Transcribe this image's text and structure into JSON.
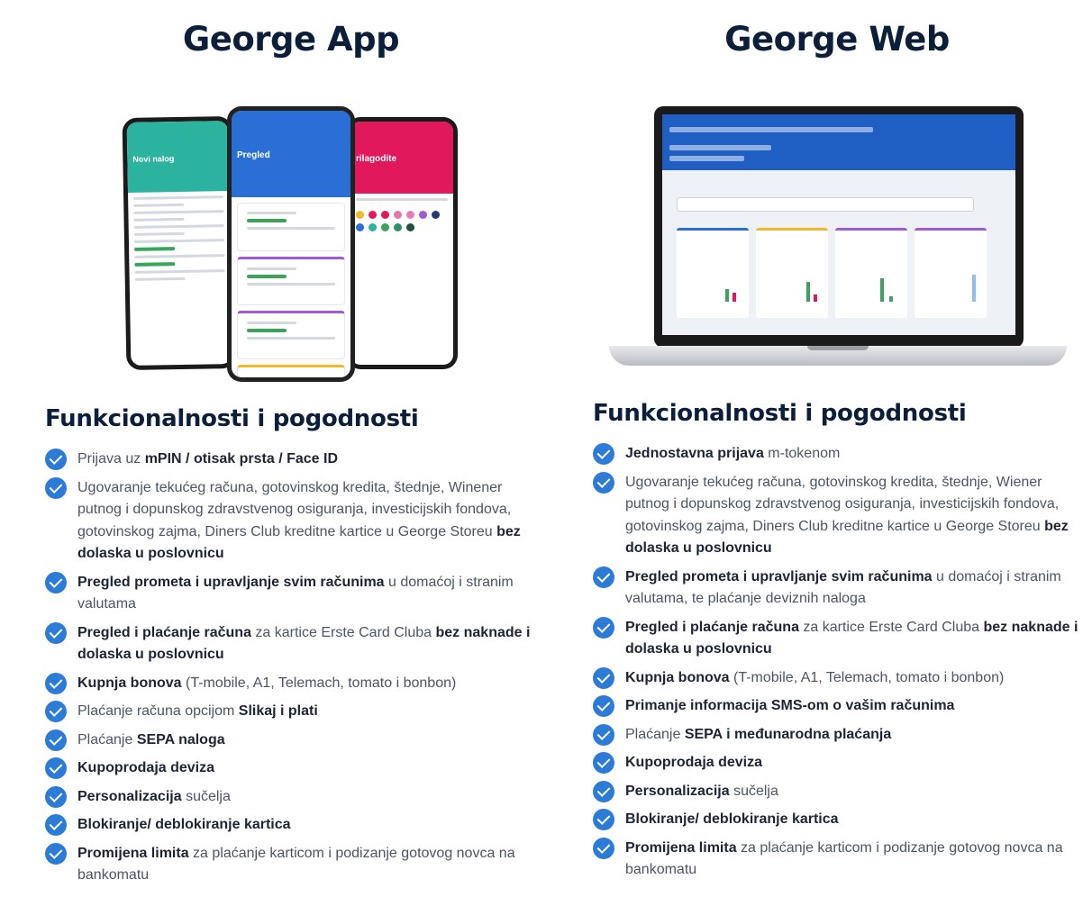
{
  "left": {
    "title": "George App",
    "subtitle": "Funkcionalnosti i pogodnosti",
    "features": [
      [
        {
          "t": "Prijava uz ",
          "b": false
        },
        {
          "t": "mPIN / otisak prsta / Face ID",
          "b": true
        }
      ],
      [
        {
          "t": "Ugovaranje tekućeg računa, gotovinskog kredita, štednje, Winener putnog i dopunskog zdravstvenog osiguranja, investicijskih fondova, gotovinskog zajma, Diners Club kreditne kartice u George Storeu ",
          "b": false
        },
        {
          "t": "bez dolaska u poslovnicu",
          "b": true
        }
      ],
      [
        {
          "t": "Pregled prometa i upravljanje svim računima",
          "b": true
        },
        {
          "t": " u domaćoj i stranim valutama",
          "b": false
        }
      ],
      [
        {
          "t": "Pregled i plaćanje računa",
          "b": true
        },
        {
          "t": " za kartice Erste Card Cluba ",
          "b": false
        },
        {
          "t": "bez naknade i dolaska u poslovnicu",
          "b": true
        }
      ],
      [
        {
          "t": "Kupnja bonova",
          "b": true
        },
        {
          "t": " (T-mobile, A1, Telemach, tomato i bonbon)",
          "b": false
        }
      ],
      [
        {
          "t": "Plaćanje računa opcijom ",
          "b": false
        },
        {
          "t": "Slikaj i plati",
          "b": true
        }
      ],
      [
        {
          "t": "Plaćanje ",
          "b": false
        },
        {
          "t": "SEPA naloga",
          "b": true
        }
      ],
      [
        {
          "t": "Kupoprodaja deviza",
          "b": true
        }
      ],
      [
        {
          "t": "Personalizacija",
          "b": true
        },
        {
          "t": " sučelja",
          "b": false
        }
      ],
      [
        {
          "t": "Blokiranje/ deblokiranje kartica",
          "b": true
        }
      ],
      [
        {
          "t": "Promijena limita",
          "b": true
        },
        {
          "t": " za plaćanje karticom i podizanje gotovog novca na bankomatu",
          "b": false
        }
      ]
    ]
  },
  "right": {
    "title": "George Web",
    "subtitle": "Funkcionalnosti i pogodnosti",
    "features": [
      [
        {
          "t": "Jednostavna prijava",
          "b": true
        },
        {
          "t": " m-tokenom",
          "b": false
        }
      ],
      [
        {
          "t": "Ugovaranje tekućeg računa, gotovinskog kredita, štednje, Wiener putnog i dopunskog zdravstvenog osiguranja, investicijskih fondova, gotovinskog zajma, Diners Club kreditne kartice u George Storeu ",
          "b": false
        },
        {
          "t": "bez dolaska u poslovnicu",
          "b": true
        }
      ],
      [
        {
          "t": "Pregled prometa i upravljanje svim računima",
          "b": true
        },
        {
          "t": " u domaćoj i stranim valutama, te plaćanje deviznih naloga",
          "b": false
        }
      ],
      [
        {
          "t": "Pregled i plaćanje računa",
          "b": true
        },
        {
          "t": " za kartice Erste Card Cluba ",
          "b": false
        },
        {
          "t": "bez naknade i dolaska u poslovnicu",
          "b": true
        }
      ],
      [
        {
          "t": "Kupnja bonova",
          "b": true
        },
        {
          "t": " (T-mobile, A1, Telemach, tomato i bonbon)",
          "b": false
        }
      ],
      [
        {
          "t": "Primanje informacija SMS-om o vašim računima",
          "b": true
        }
      ],
      [
        {
          "t": "Plaćanje ",
          "b": false
        },
        {
          "t": "SEPA i međunarodna plaćanja",
          "b": true
        }
      ],
      [
        {
          "t": "Kupoprodaja deviza",
          "b": true
        }
      ],
      [
        {
          "t": "Personalizacija",
          "b": true
        },
        {
          "t": " sučelja",
          "b": false
        }
      ],
      [
        {
          "t": "Blokiranje/ deblokiranje kartica",
          "b": true
        }
      ],
      [
        {
          "t": "Promijena limita",
          "b": true
        },
        {
          "t": " za plaćanje karticom i podizanje gotovog novca na bankomatu",
          "b": false
        }
      ]
    ]
  },
  "colors": {
    "accent": "#2c7bd6",
    "heading": "#0b1f3a",
    "body": "#4a5566"
  },
  "icons": {
    "check": "check-circle-icon"
  }
}
